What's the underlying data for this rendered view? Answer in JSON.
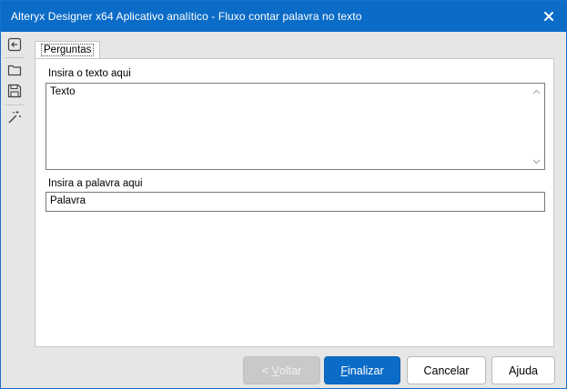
{
  "window": {
    "title": "Alteryx Designer x64 Aplicativo analítico - Fluxo contar palavra no texto",
    "close_icon": "close-icon"
  },
  "toolbar": {
    "items": [
      {
        "icon": "back-to-canvas-icon"
      },
      {
        "icon": "folder-open-icon"
      },
      {
        "icon": "save-icon"
      },
      {
        "icon": "magic-wand-icon"
      }
    ]
  },
  "tabs": [
    {
      "label": "Perguntas",
      "selected": true
    }
  ],
  "form": {
    "text_label": "Insira o texto aqui",
    "text_value": "Texto",
    "word_label": "Insira a palavra aqui",
    "word_value": "Palavra"
  },
  "buttons": {
    "back_prefix": "< ",
    "back_mnemonic": "V",
    "back_rest": "oltar",
    "finish_mnemonic": "F",
    "finish_rest": "inalizar",
    "cancel": "Cancelar",
    "help": "Ajuda"
  },
  "colors": {
    "titlebar": "#0b6cc8",
    "primary_button": "#0b6cc8",
    "disabled_button": "#c9c9c9"
  }
}
